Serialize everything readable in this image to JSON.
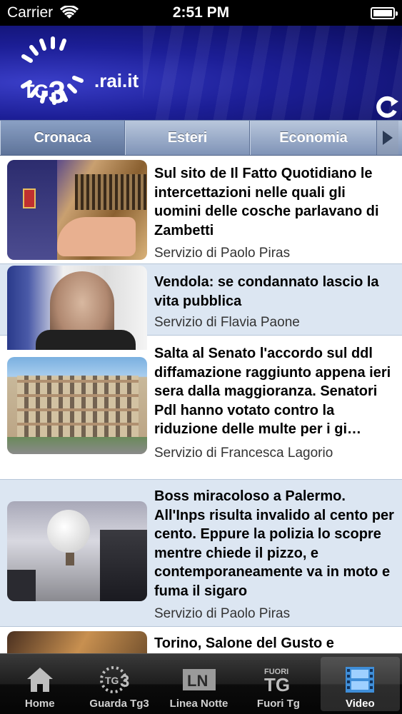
{
  "status_bar": {
    "carrier": "Carrier",
    "time": "2:51 PM"
  },
  "header": {
    "logo_main": "TG",
    "logo_number": "3",
    "logo_domain": ".rai.it"
  },
  "tabs": [
    {
      "label": "Cronaca",
      "selected": true
    },
    {
      "label": "Esteri",
      "selected": false
    },
    {
      "label": "Economia",
      "selected": false
    }
  ],
  "news": [
    {
      "title": "Sul sito de Il Fatto Quotidiano le intercettazioni nelle quali gli uomini delle cosche parlavano di Zambetti",
      "byline": "Servizio di Paolo Piras"
    },
    {
      "title": "Vendola: se condannato lascio la vita pubblica",
      "byline": "Servizio di Flavia Paone"
    },
    {
      "title": "Salta al Senato l'accordo sul ddl diffamazione raggiunto appena ieri sera dalla maggioranza. Senatori Pdl hanno votato contro la riduzione delle multe per i gi…",
      "byline": "Servizio di Francesca Lagorio"
    },
    {
      "title": "Boss miracoloso a Palermo. All'Inps risulta invalido al cento per cento. Eppure la polizia lo scopre mentre chiede il pizzo, e contemporaneamente va in moto e fuma il sigaro",
      "byline": "Servizio di Paolo Piras"
    },
    {
      "title": "Torino, Salone del Gusto e",
      "byline": ""
    }
  ],
  "tabbar": [
    {
      "label": "Home",
      "icon": "home-icon",
      "active": false
    },
    {
      "label": "Guarda Tg3",
      "icon": "tg3-icon",
      "active": false
    },
    {
      "label": "Linea Notte",
      "icon": "ln-icon",
      "active": false
    },
    {
      "label": "Fuori Tg",
      "icon": "fuori-tg-icon",
      "active": false
    },
    {
      "label": "Video",
      "icon": "film-icon",
      "active": true
    }
  ],
  "colors": {
    "header_blue": "#1c1e96",
    "alt_row": "#dce6f2",
    "tab_gradient_top": "#b9c7dc"
  }
}
